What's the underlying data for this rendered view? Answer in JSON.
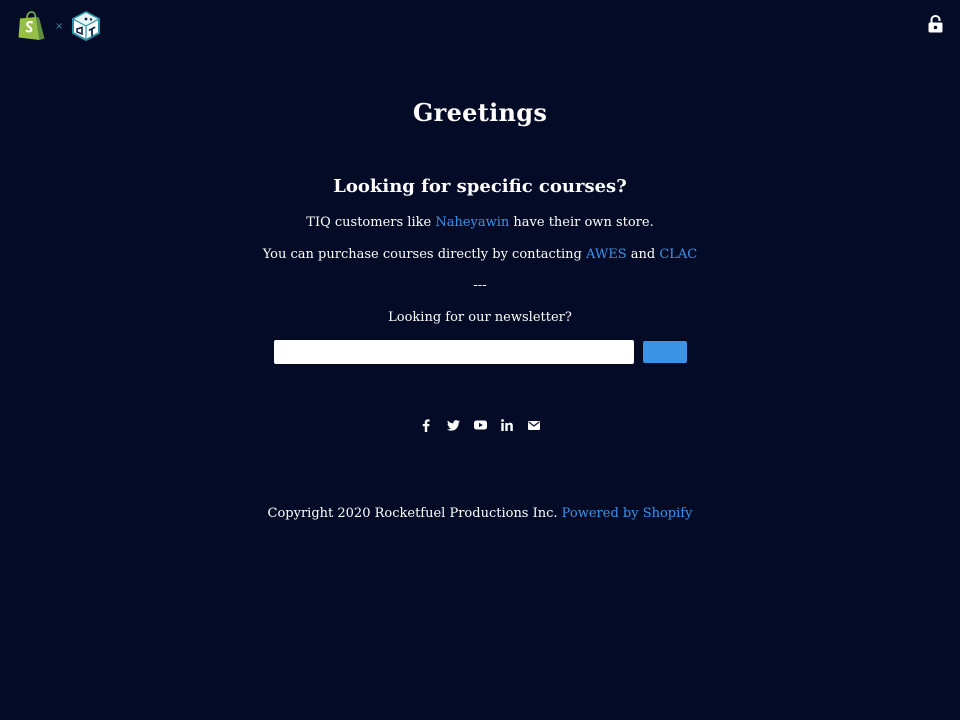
{
  "header": {
    "logos": [
      "shopify-bag-icon",
      "cube-logo-icon"
    ],
    "separator": "×",
    "lock_icon": "lock-icon"
  },
  "main": {
    "title": "Greetings",
    "heading": "Looking for specific courses?",
    "customers_line": {
      "prefix": "TIQ customers like ",
      "link": "Naheyawin",
      "suffix": " have their own store."
    },
    "purchase_line": {
      "prefix": "You can purchase courses directly by contacting ",
      "link1": "AWES",
      "middle": " and ",
      "link2": "CLAC"
    },
    "divider": "---",
    "newsletter_prompt": "Looking for our newsletter?"
  },
  "newsletter": {
    "email_placeholder": "",
    "email_value": "",
    "subscribe_label": ""
  },
  "social": {
    "icons": [
      "facebook-icon",
      "twitter-icon",
      "youtube-icon",
      "linkedin-icon",
      "email-icon"
    ]
  },
  "footer": {
    "copyright": "Copyright 2020 Rocketfuel Productions Inc. ",
    "powered_by": "Powered by Shopify"
  },
  "colors": {
    "background": "#030b26",
    "link": "#3c93e8",
    "button": "#3b93e6",
    "text": "#ffffff"
  }
}
